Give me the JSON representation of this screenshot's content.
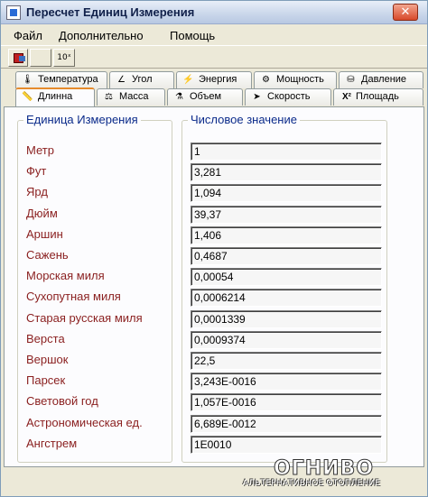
{
  "window": {
    "title": "Пересчет Единиц Измерения",
    "close_glyph": "✕"
  },
  "menu": [
    "Файл",
    "Дополнительно",
    "Помощь"
  ],
  "toolbar": {
    "exponent_label": "10ˣ"
  },
  "tabs_row1": [
    {
      "label": "Температура",
      "icon": "thermometer-icon",
      "glyph": "🌡"
    },
    {
      "label": "Угол",
      "icon": "angle-icon",
      "glyph": "∠"
    },
    {
      "label": "Энергия",
      "icon": "energy-icon",
      "glyph": "⚡"
    },
    {
      "label": "Мощность",
      "icon": "power-icon",
      "glyph": "⚙"
    },
    {
      "label": "Давление",
      "icon": "pressure-icon",
      "glyph": "⛁"
    }
  ],
  "tabs_row2": [
    {
      "label": "Длинна",
      "icon": "ruler-icon",
      "glyph": "📏",
      "active": true
    },
    {
      "label": "Масса",
      "icon": "weight-icon",
      "glyph": "⚖"
    },
    {
      "label": "Объем",
      "icon": "flask-icon",
      "glyph": "⚗"
    },
    {
      "label": "Скорость",
      "icon": "speed-icon",
      "glyph": "➤"
    },
    {
      "label": "Площадь",
      "icon": "area-icon",
      "glyph": "X²"
    }
  ],
  "groups": {
    "units_title": "Единица Измерения",
    "values_title": "Числовое значение"
  },
  "rows": [
    {
      "unit": "Метр",
      "value": "1"
    },
    {
      "unit": "Фут",
      "value": "3,281"
    },
    {
      "unit": "Ярд",
      "value": "1,094"
    },
    {
      "unit": "Дюйм",
      "value": "39,37"
    },
    {
      "unit": "Аршин",
      "value": "1,406"
    },
    {
      "unit": "Сажень",
      "value": "0,4687"
    },
    {
      "unit": "Морская миля",
      "value": "0,00054"
    },
    {
      "unit": "Сухопутная миля",
      "value": "0,0006214"
    },
    {
      "unit": "Старая русская миля",
      "value": "0,0001339"
    },
    {
      "unit": "Верста",
      "value": "0,0009374"
    },
    {
      "unit": "Вершок",
      "value": "22,5"
    },
    {
      "unit": "Парсек",
      "value": "3,243E-0016"
    },
    {
      "unit": "Световой год",
      "value": "1,057E-0016"
    },
    {
      "unit": "Астрономическая ед.",
      "value": "6,689E-0012"
    },
    {
      "unit": "Ангстрем",
      "value": "1E0010"
    }
  ],
  "watermark": {
    "brand": "ОГНИВО",
    "tagline": "АЛЬТЕРНАТИВНОЕ ОТОПЛЕНИЕ"
  },
  "colors": {
    "accent_tab": "#e68b2c",
    "unit_text": "#8a1f1f",
    "group_title": "#0a2a8a"
  }
}
